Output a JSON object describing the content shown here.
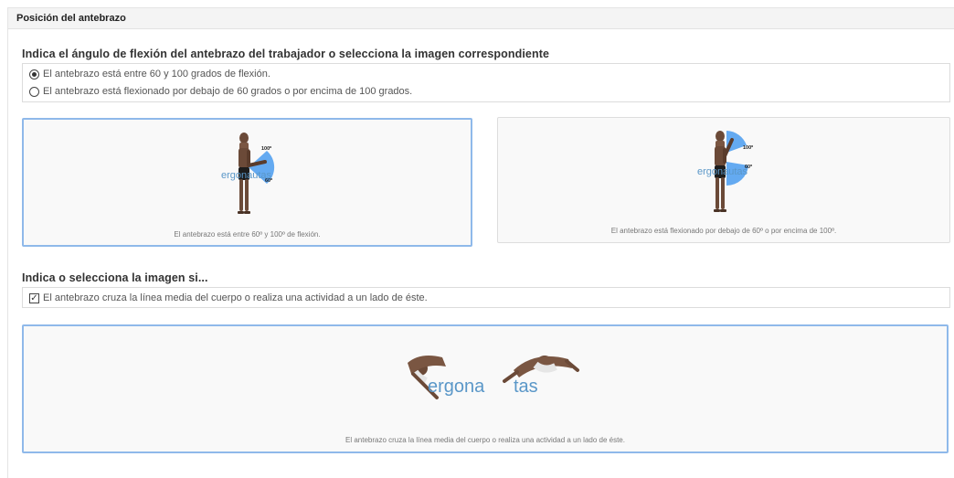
{
  "section": {
    "title": "Posición del antebrazo"
  },
  "question1": {
    "title": "Indica el ángulo de flexión del antebrazo del trabajador o selecciona la imagen correspondiente",
    "options": [
      {
        "label": "El antebrazo está entre 60 y 100 grados de flexión.",
        "checked": true
      },
      {
        "label": "El antebrazo está flexionado por debajo de 60 grados o por encima de 100 grados.",
        "checked": false
      }
    ],
    "cards": [
      {
        "caption": "El antebrazo está entre 60º y 100º de flexión.",
        "selected": true,
        "label_top": "100º",
        "label_bottom": "60º",
        "logo": "ergonautas"
      },
      {
        "caption": "El antebrazo está flexionado por debajo de 60º o por encima de 100º.",
        "selected": false,
        "label_top": "100º",
        "label_bottom": "60º",
        "logo": "ergonautas"
      }
    ]
  },
  "question2": {
    "title": "Indica o selecciona la imagen si...",
    "options": [
      {
        "label": "El antebrazo cruza la línea media del cuerpo o realiza una actividad a un lado de éste.",
        "checked": true
      }
    ],
    "cards": [
      {
        "caption": "El antebrazo cruza la línea media del cuerpo o realiza una actividad a un lado de éste.",
        "selected": true,
        "logo_part1": "ergona",
        "logo_part2": "tas"
      }
    ]
  },
  "colors": {
    "accent_border": "#8fb9ea",
    "angle_fill": "#4a9cf0",
    "logo_blue": "#5a97c8"
  },
  "icons": {
    "radio_checked": "radio-checked-icon",
    "radio_unchecked": "radio-unchecked-icon",
    "checkbox_checked": "checkbox-checked-icon"
  }
}
